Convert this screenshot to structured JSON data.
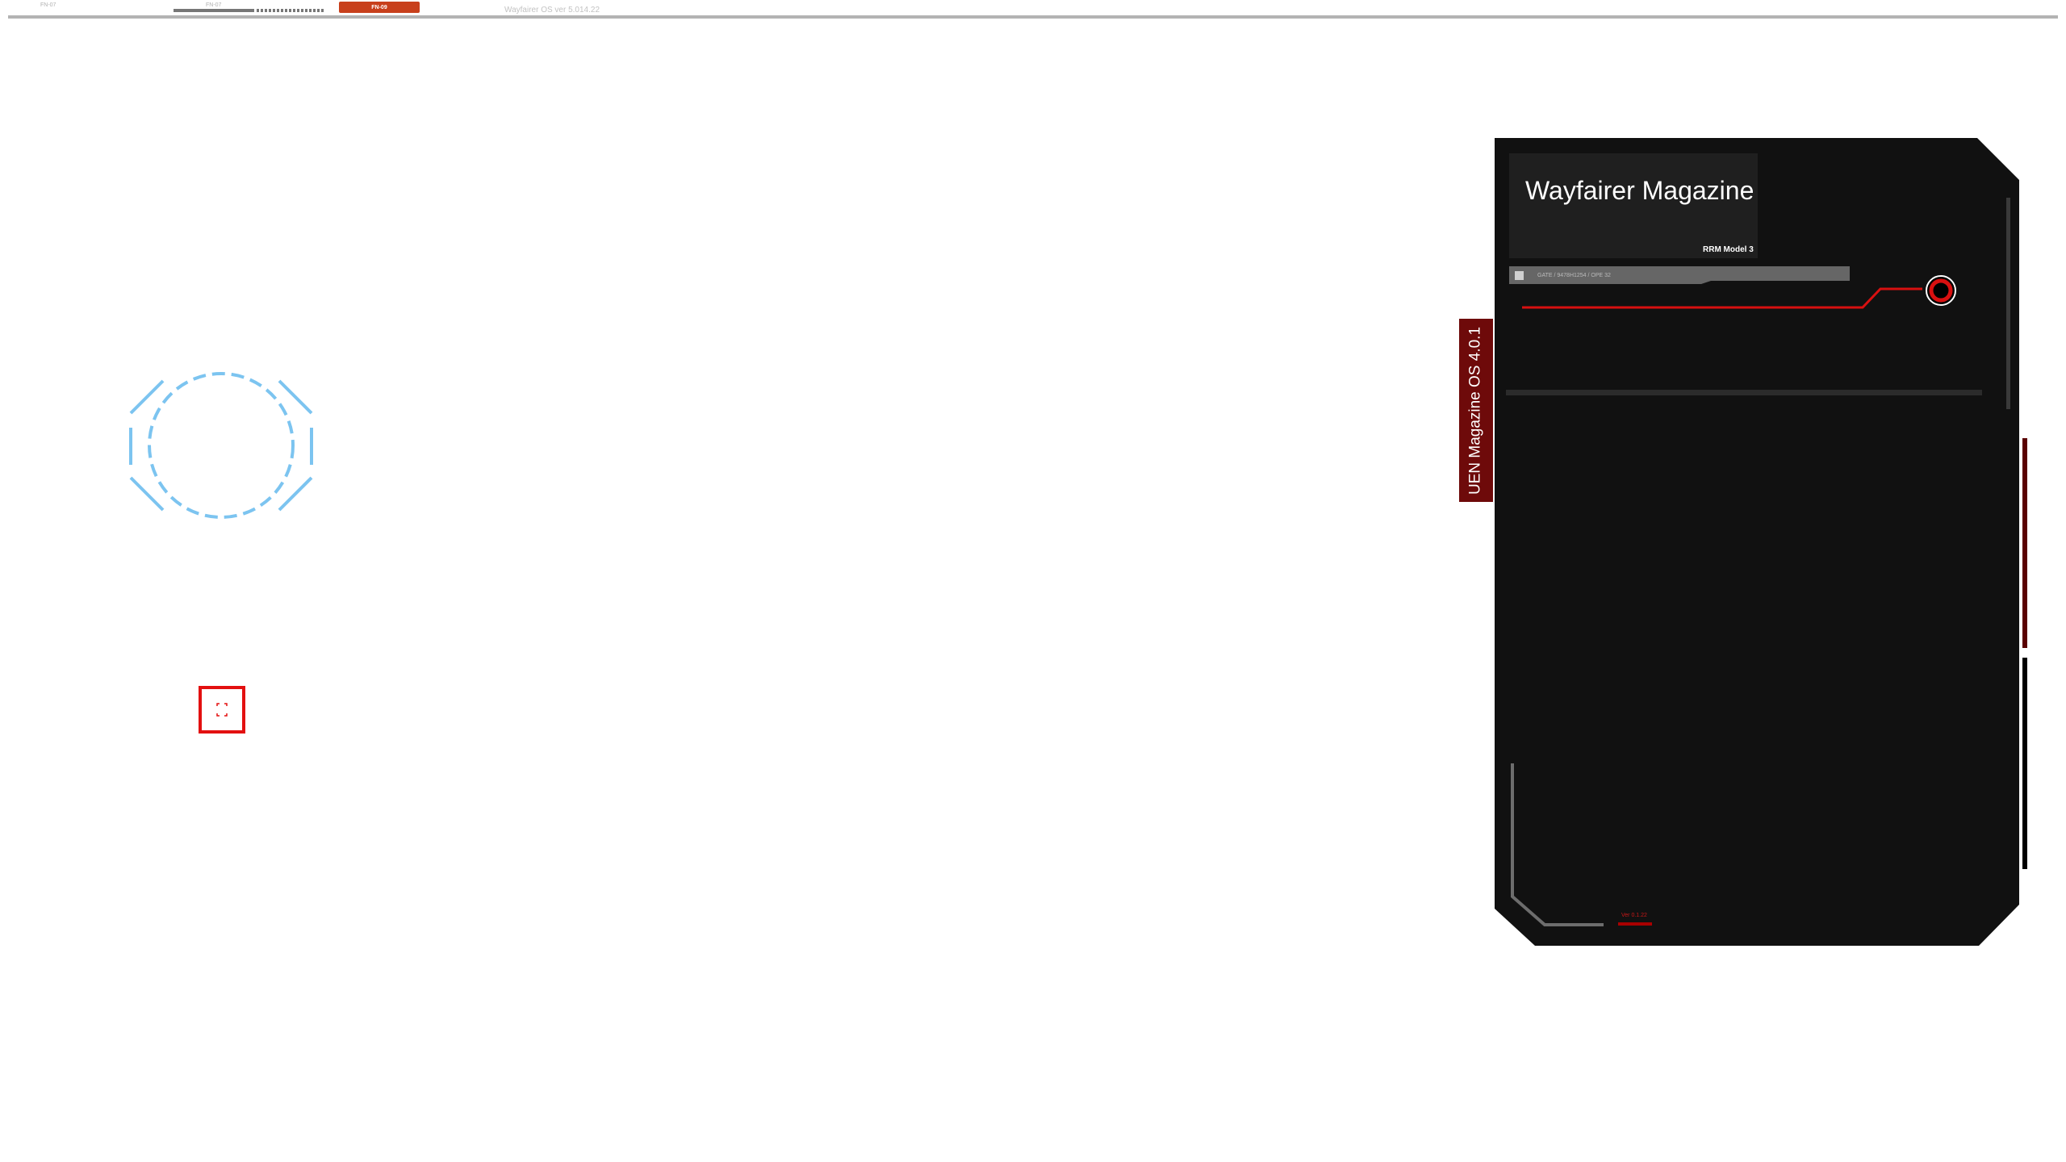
{
  "top_bar": {
    "tabs": [
      {
        "label": "FN-07"
      },
      {
        "label": "FN-07"
      },
      {
        "label": "FN-09"
      }
    ],
    "os_version": "Wayfairer OS ver 5.014.22"
  },
  "side_tab": {
    "label": "UEN Magazine OS 4.0.1"
  },
  "panel": {
    "title": "Wayfairer Magazine",
    "model": "RRM Model 3",
    "info_text": "GATE / 9478H1254 / OPE 32",
    "version": "Ver 0.1.22"
  },
  "colors": {
    "panel_bg": "#111111",
    "accent_red": "#d81010",
    "tab_orange": "#c8401c",
    "ring_blue": "#7cc4f0"
  },
  "icons": {
    "loader": "dashed-octagon-ring-icon",
    "focus": "focus-frame-icon",
    "record": "record-ring-icon"
  }
}
